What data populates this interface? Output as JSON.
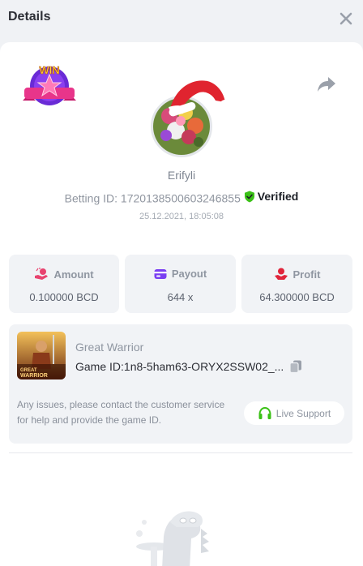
{
  "header": {
    "title": "Details"
  },
  "user": {
    "name": "Erifyli",
    "betting_id_label": "Betting ID: ",
    "betting_id": "1720138500603246855",
    "verified_label": "Verified",
    "timestamp": "25.12.2021, 18:05:08"
  },
  "badge": {
    "text": "WIN"
  },
  "stats": [
    {
      "label": "Amount",
      "value": "0.100000 BCD",
      "icon": "amount-hand-icon"
    },
    {
      "label": "Payout",
      "value": "644 x",
      "icon": "payout-card-icon"
    },
    {
      "label": "Profit",
      "value": "64.300000 BCD",
      "icon": "profit-hand-icon"
    }
  ],
  "game": {
    "name": "Great Warrior",
    "id_label": "Game ID:",
    "id_value": "1n8-5ham63-ORYX2SSW02_...",
    "thumb_text_1": "GREAT",
    "thumb_text_2": "WARRIOR"
  },
  "support": {
    "message": "Any issues, please contact the customer service for help and provide the game ID.",
    "button_label": "Live Support"
  },
  "colors": {
    "accent_green": "#3bc117",
    "icon_pink": "#e8436f",
    "icon_purple": "#7a3ff2"
  }
}
